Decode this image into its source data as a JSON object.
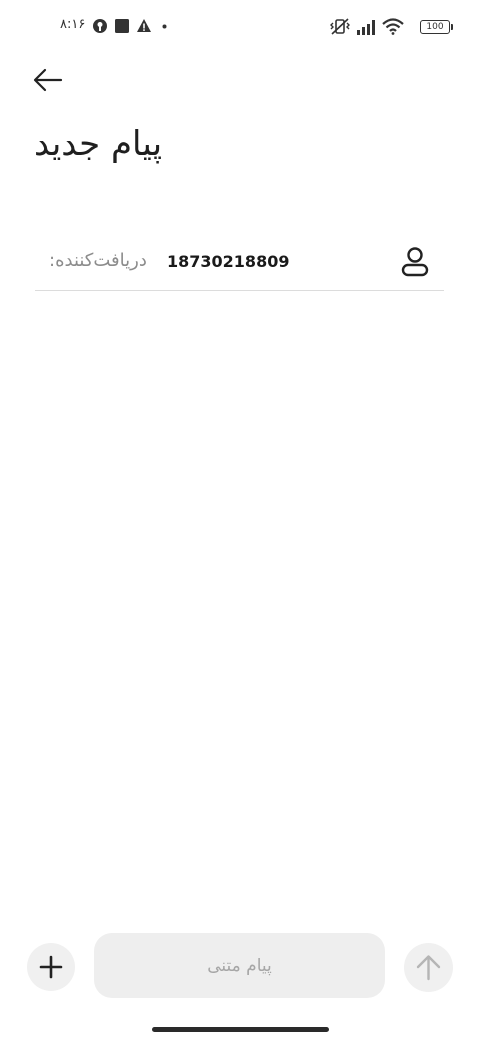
{
  "status_bar": {
    "time": "۸:۱۶",
    "left_icons": [
      "vpn-key-icon",
      "stop-square-icon",
      "warning-icon",
      "dot-icon"
    ],
    "right_icons": [
      "vibrate-off-icon",
      "signal-icon",
      "wifi-icon"
    ],
    "battery_level": "100"
  },
  "header": {
    "back_icon": "arrow-left-icon",
    "title": "پیام جدید"
  },
  "recipient": {
    "label": "دریافت‌کننده:",
    "number": "18730218809",
    "contact_icon": "person-icon"
  },
  "compose": {
    "add_icon": "plus-icon",
    "placeholder": "پیام متنی",
    "value": "",
    "send_icon": "arrow-up-icon"
  },
  "colors": {
    "background": "#ffffff",
    "input_background": "#eeeeee",
    "button_background": "#f0f0f0",
    "text_primary": "#1f1f1f",
    "text_hint": "#a6a6a6",
    "divider": "#dcdcdc"
  }
}
